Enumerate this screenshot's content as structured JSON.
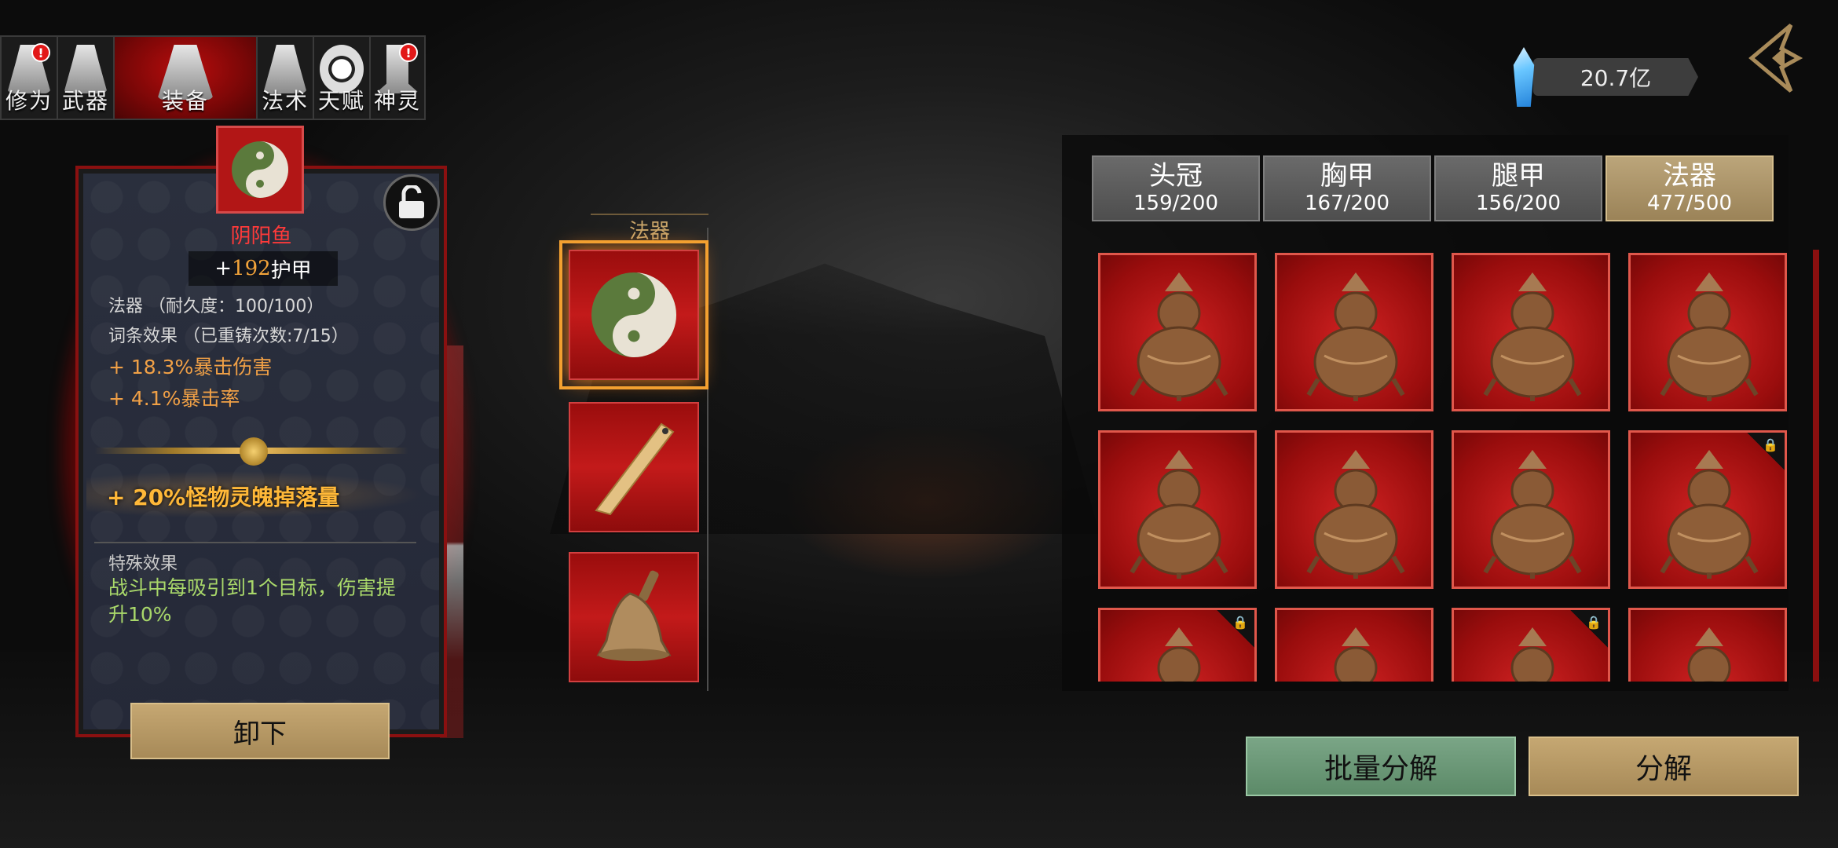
{
  "top_tabs": [
    {
      "label": "修为",
      "icon": "meditation-figure-icon",
      "alert": "!"
    },
    {
      "label": "武器",
      "icon": "sword-icon",
      "alert": ""
    },
    {
      "label": "装备",
      "icon": "robe-icon",
      "alert": "",
      "active": true
    },
    {
      "label": "法术",
      "icon": "scroll-gourd-icon",
      "alert": ""
    },
    {
      "label": "天赋",
      "icon": "bagua-icon",
      "alert": ""
    },
    {
      "label": "神灵",
      "icon": "spirit-tablet-icon",
      "alert": "!"
    }
  ],
  "currency": {
    "amount": "20.7亿",
    "icon": "blue-crystal-icon"
  },
  "item_card": {
    "name": "阴阳鱼",
    "armor_prefix": "+",
    "armor_value": "192",
    "armor_suffix": "护甲",
    "durability": "法器 （耐久度：100/100）",
    "affix_title": "词条效果 （已重铸次数:7/15）",
    "affix_1": "+ 18.3%暴击伤害",
    "affix_2": "+ 4.1%暴击率",
    "bonus": "+ 20%怪物灵魄掉落量",
    "special_title": "特殊效果",
    "special_text": "战斗中每吸引到1个目标，伤害提升10%",
    "unequip_label": "卸下"
  },
  "slot_column": {
    "header": "法器",
    "slots": [
      {
        "item": "yin-yang-fish-icon",
        "selected": true
      },
      {
        "item": "wooden-ruler-icon",
        "selected": false
      },
      {
        "item": "bronze-bell-icon",
        "selected": false
      }
    ]
  },
  "inventory": {
    "tabs": [
      {
        "label": "头冠",
        "count": "159/200"
      },
      {
        "label": "胸甲",
        "count": "167/200"
      },
      {
        "label": "腿甲",
        "count": "156/200"
      },
      {
        "label": "法器",
        "count": "477/500",
        "active": true
      }
    ],
    "items": [
      {
        "item": "bronze-gourd-icon",
        "locked": false
      },
      {
        "item": "bronze-gourd-icon",
        "locked": false
      },
      {
        "item": "bronze-gourd-icon",
        "locked": false
      },
      {
        "item": "bronze-gourd-icon",
        "locked": false
      },
      {
        "item": "bronze-gourd-icon",
        "locked": false
      },
      {
        "item": "bronze-gourd-icon",
        "locked": false
      },
      {
        "item": "bronze-gourd-icon",
        "locked": false
      },
      {
        "item": "bronze-gourd-icon",
        "locked": true
      },
      {
        "item": "bronze-gourd-icon",
        "locked": true
      },
      {
        "item": "bronze-gourd-icon",
        "locked": false
      },
      {
        "item": "bronze-gourd-icon",
        "locked": true
      },
      {
        "item": "bronze-gourd-icon",
        "locked": false
      }
    ],
    "batch_label": "批量分解",
    "decompose_label": "分解"
  },
  "colors": {
    "accent_red": "#b80d0d",
    "gold": "#f3a43a",
    "green_text": "#a9d86a"
  }
}
